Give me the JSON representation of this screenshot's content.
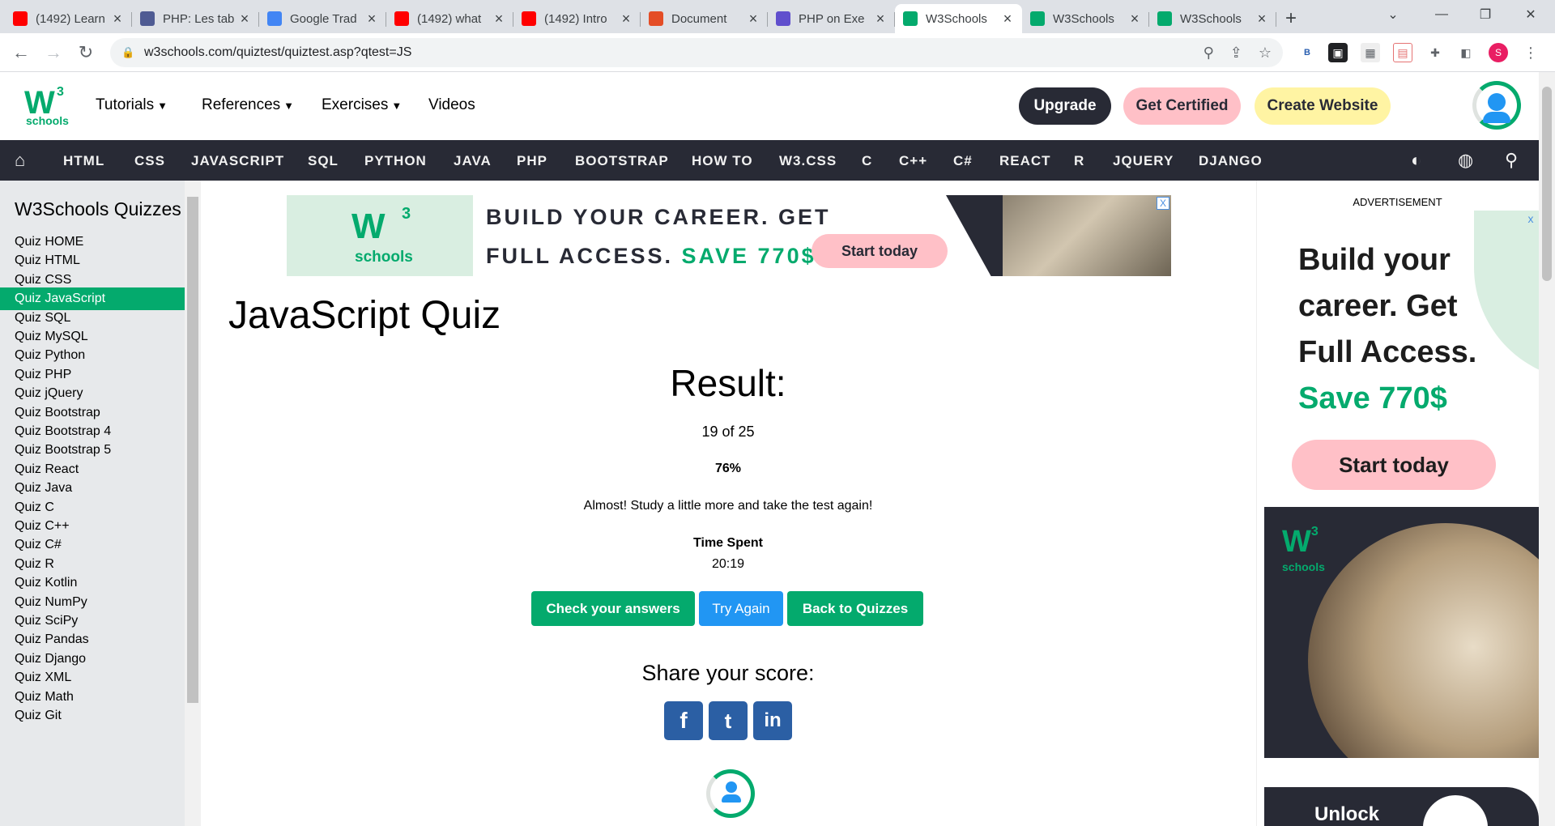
{
  "browser": {
    "tabs": [
      {
        "title": "(1492) Learn",
        "favicon": "youtube-icon",
        "color": "#ff0000"
      },
      {
        "title": "PHP: Les tab",
        "favicon": "php-icon",
        "color": "#4f5b93"
      },
      {
        "title": "Google Trad",
        "favicon": "google-translate-icon",
        "color": "#4285f4"
      },
      {
        "title": "(1492) what",
        "favicon": "youtube-icon",
        "color": "#ff0000"
      },
      {
        "title": "(1492) Intro",
        "favicon": "youtube-icon",
        "color": "#ff0000"
      },
      {
        "title": "Document",
        "favicon": "document-icon",
        "color": "#e44d26"
      },
      {
        "title": "PHP on Exe",
        "favicon": "exercism-icon",
        "color": "#604fcd"
      },
      {
        "title": "W3Schools",
        "favicon": "w3schools-icon",
        "color": "#04aa6d",
        "active": true
      },
      {
        "title": "W3Schools",
        "favicon": "w3schools-icon",
        "color": "#04aa6d"
      },
      {
        "title": "W3Schools",
        "favicon": "w3schools-icon",
        "color": "#04aa6d"
      }
    ],
    "url": "w3schools.com/quiztest/quiztest.asp?qtest=JS",
    "profile_initial": "S"
  },
  "header": {
    "logo_text": "W",
    "logo_superscript": "3",
    "logo_subtitle": "schools",
    "nav": [
      "Tutorials",
      "References",
      "Exercises",
      "Videos"
    ],
    "upgrade": "Upgrade",
    "get_certified": "Get Certified",
    "create_website": "Create Website"
  },
  "topnav": {
    "items": [
      "HTML",
      "CSS",
      "JAVASCRIPT",
      "SQL",
      "PYTHON",
      "JAVA",
      "PHP",
      "BOOTSTRAP",
      "HOW TO",
      "W3.CSS",
      "C",
      "C++",
      "C#",
      "REACT",
      "R",
      "JQUERY",
      "DJANGO"
    ]
  },
  "sidebar": {
    "title": "W3Schools Quizzes",
    "items": [
      "Quiz HOME",
      "Quiz HTML",
      "Quiz CSS",
      "Quiz JavaScript",
      "Quiz SQL",
      "Quiz MySQL",
      "Quiz Python",
      "Quiz PHP",
      "Quiz jQuery",
      "Quiz Bootstrap",
      "Quiz Bootstrap 4",
      "Quiz Bootstrap 5",
      "Quiz React",
      "Quiz Java",
      "Quiz C",
      "Quiz C++",
      "Quiz C#",
      "Quiz R",
      "Quiz Kotlin",
      "Quiz NumPy",
      "Quiz SciPy",
      "Quiz Pandas",
      "Quiz Django",
      "Quiz XML",
      "Quiz Math",
      "Quiz Git"
    ],
    "active_index": 3
  },
  "banner": {
    "logo_text": "W",
    "logo_superscript": "3",
    "logo_subtitle": "schools",
    "line1": "BUILD YOUR CAREER. GET",
    "line2_prefix": "FULL ACCESS. ",
    "line2_highlight": "SAVE 770$",
    "button": "Start today",
    "close": "X"
  },
  "main": {
    "title": "JavaScript Quiz",
    "result_heading": "Result:",
    "score": "19 of 25",
    "percent": "76%",
    "message": "Almost! Study a little more and take the test again!",
    "time_label": "Time Spent",
    "time_value": "20:19",
    "buttons": {
      "check": "Check your answers",
      "try_again": "Try Again",
      "back": "Back to Quizzes"
    },
    "share_heading": "Share your score:",
    "share_icons": [
      {
        "name": "facebook-icon",
        "glyph": "f"
      },
      {
        "name": "twitter-icon",
        "glyph": "t"
      },
      {
        "name": "linkedin-icon",
        "glyph": "in"
      }
    ]
  },
  "ad": {
    "label": "ADVERTISEMENT",
    "lines": [
      "Build your",
      "career. Get",
      "Full Access."
    ],
    "highlight": "Save 770$",
    "button": "Start today",
    "logo_text": "W",
    "logo_superscript": "3",
    "logo_subtitle": "schools",
    "unlock": "Unlock",
    "close": "x"
  },
  "colors": {
    "brand_green": "#04aa6d",
    "dark": "#282a35",
    "pink": "#ffc0c7",
    "yellow": "#fff4a3",
    "blue": "#2196f3"
  }
}
